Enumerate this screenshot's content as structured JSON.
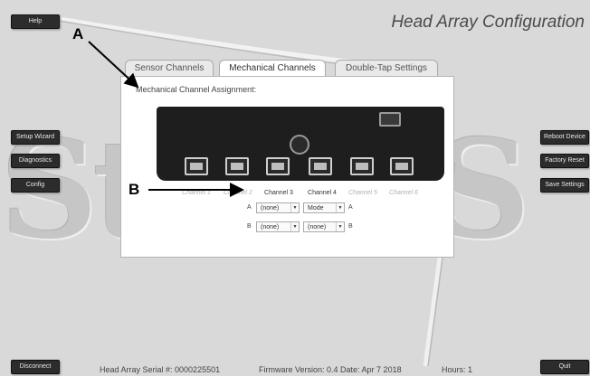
{
  "app": {
    "title": "Head Array Configuration",
    "logo_text_left": "Stea",
    "logo_text_right": "S"
  },
  "buttons": {
    "help": "Help",
    "setup_wizard": "Setup Wizard",
    "diagnostics": "Diagnostics",
    "config": "Config",
    "reboot_device": "Reboot Device",
    "factory_reset": "Factory Reset",
    "save_settings": "Save Settings",
    "disconnect": "Disconnect",
    "quit": "Quit"
  },
  "tabs": [
    {
      "label": "Sensor Channels",
      "active": false
    },
    {
      "label": "Mechanical Channels",
      "active": true
    },
    {
      "label": "Double-Tap Settings",
      "active": false
    }
  ],
  "panel": {
    "title": "Mechanical Channel Assignment:",
    "channels": [
      {
        "label": "Channel 1",
        "active": false
      },
      {
        "label": "Channel 2",
        "active": false
      },
      {
        "label": "Channel 3",
        "active": true
      },
      {
        "label": "Channel 4",
        "active": true
      },
      {
        "label": "Channel 5",
        "active": false
      },
      {
        "label": "Channel 6",
        "active": false
      }
    ],
    "row_a": {
      "label": "A",
      "ch3_value": "(none)",
      "ch4_value": "Mode",
      "suffix": "A"
    },
    "row_b": {
      "label": "B",
      "ch3_value": "(none)",
      "ch4_value": "(none)",
      "suffix": "B"
    }
  },
  "footer": {
    "serial": "Head Array Serial #: 0000225501",
    "firmware": "Firmware Version: 0.4 Date: Apr  7 2018",
    "hours": "Hours: 1"
  },
  "annotations": {
    "a": "A",
    "b": "B"
  },
  "colors": {
    "button_bg": "#2c2c2c",
    "panel_bg": "#ffffff",
    "page_bg": "#d9d9d9",
    "device_bg": "#1e1e1e"
  }
}
